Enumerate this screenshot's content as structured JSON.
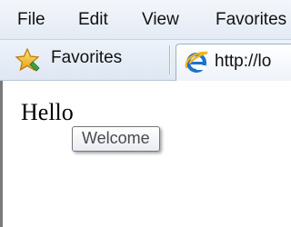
{
  "menubar": {
    "items": [
      {
        "label": "File"
      },
      {
        "label": "Edit"
      },
      {
        "label": "View"
      },
      {
        "label": "Favorites"
      }
    ]
  },
  "favorites_bar": {
    "favorites_label": "Favorites",
    "star_icon": "favorites-star-icon",
    "tab": {
      "icon": "ie-page-icon",
      "label": "http://lo"
    }
  },
  "page": {
    "heading": "Hello",
    "tooltip": "Welcome"
  },
  "colors": {
    "toolbar_bg": "#e4ebf5",
    "tooltip_text": "#4a4a4a",
    "star": "#f2b01e",
    "ie_blue": "#1a73c9"
  }
}
